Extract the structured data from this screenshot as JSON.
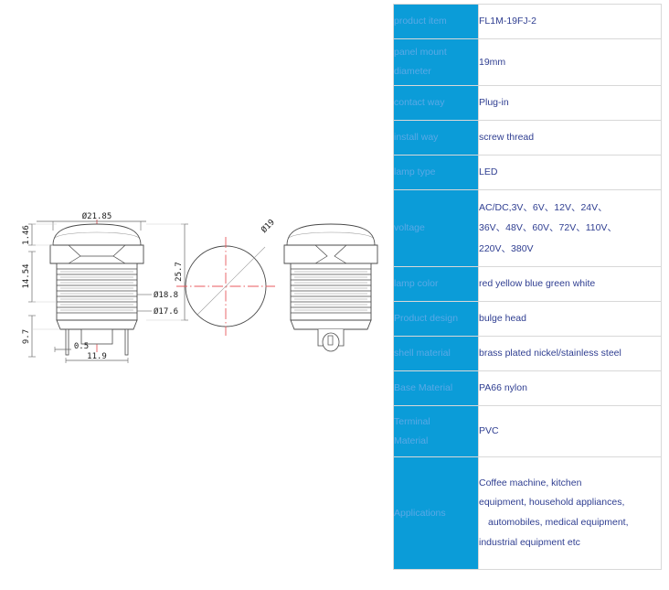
{
  "drawing": {
    "title": "push-button-switch-technical-drawing",
    "views": [
      {
        "name": "front-elevation-view"
      },
      {
        "name": "top-plan-view"
      },
      {
        "name": "side-elevation-view"
      }
    ],
    "dimensions": {
      "outer_head_diameter": "Ø21.85",
      "head_height": "1.46",
      "thread_length": "14.54",
      "terminal_length": "9.7",
      "thread_outer_diameter": "Ø18.8",
      "thread_inner_diameter": "Ø17.6",
      "total_height": "25.7",
      "terminal_thickness": "0.5",
      "terminal_span": "11.9",
      "panel_hole_diameter": "Ø19"
    },
    "colors": {
      "centerline": "#e8595c",
      "outline": "#4a4a4a",
      "dimension_text": "#1a1a1a"
    }
  },
  "spec_table": {
    "colors": {
      "label_background": "#0b9cd8",
      "label_text": "#5aa9e6",
      "value_text": "#2f3e91",
      "border": "#dcdcdc"
    },
    "rows": [
      {
        "label": "product item",
        "values": [
          "FL1M-19FJ-2"
        ]
      },
      {
        "label": "panel mount diameter",
        "label_lines": [
          "panel mount",
          "diameter"
        ],
        "values": [
          "19mm"
        ]
      },
      {
        "label": "contact way",
        "values": [
          "Plug-in"
        ]
      },
      {
        "label": "install way",
        "values": [
          "screw thread"
        ]
      },
      {
        "label": "lamp type",
        "values": [
          "LED"
        ]
      },
      {
        "label": "voltage",
        "values": [
          "AC/DC,3V、6V、12V、24V、",
          "36V、48V、60V、72V、110V、",
          "220V、380V"
        ]
      },
      {
        "label": "lamp color",
        "values": [
          "red yellow blue green white"
        ]
      },
      {
        "label": "Product design",
        "values": [
          "bulge head"
        ]
      },
      {
        "label": "shell material",
        "values": [
          "brass plated nickel/stainless steel"
        ]
      },
      {
        "label": "Base Material",
        "values": [
          "PA66 nylon"
        ]
      },
      {
        "label": "Terminal Material",
        "label_lines": [
          "Terminal",
          "Material"
        ],
        "values": [
          "PVC"
        ]
      },
      {
        "label": "Applications",
        "values": [
          "Coffee machine, kitchen",
          "equipment, household appliances,",
          "automobiles, medical equipment,",
          "industrial equipment etc"
        ]
      }
    ]
  }
}
